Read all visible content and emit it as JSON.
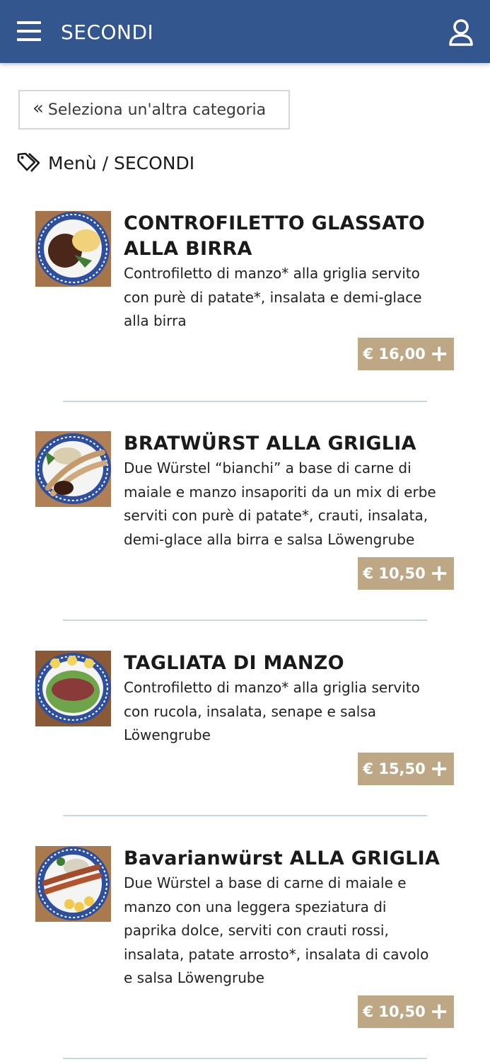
{
  "header": {
    "title": "SECONDI",
    "menu_icon": "hamburger-menu-icon",
    "user_icon": "user-icon"
  },
  "back_button": {
    "icon": "double-chevron-left-icon",
    "label": "Seleziona un'altra categoria"
  },
  "breadcrumb": {
    "icon": "tags-icon",
    "text": "Menù / SECONDI"
  },
  "colors": {
    "header_bg": "#33568f",
    "price_bg": "#bda784",
    "divider": "#c9d6e6"
  },
  "items": [
    {
      "title_lines": [
        "CONTROFILETTO GLASSATO",
        "ALLA BIRRA"
      ],
      "desc_lines": [
        "Controfiletto di manzo* alla griglia servito",
        "con purè di patate*, insalata e demi-glace",
        "alla birra"
      ],
      "price": "€ 16,00"
    },
    {
      "title_lines": [
        "BRATWÜRST ALLA GRIGLIA"
      ],
      "desc_lines": [
        "Due Würstel “bianchi” a base di carne di",
        "maiale e manzo insaporiti da un mix di erbe",
        "serviti con purè di patate*, crauti, insalata,",
        "demi-glace alla birra e salsa Löwengrube"
      ],
      "price": "€ 10,50"
    },
    {
      "title_lines": [
        "TAGLIATA DI MANZO"
      ],
      "desc_lines": [
        "Controfiletto di manzo* alla griglia servito",
        "con rucola, insalata, senape e salsa",
        "Löwengrube"
      ],
      "price": "€ 15,50"
    },
    {
      "title_lines": [
        "Bavarianwürst ALLA GRIGLIA"
      ],
      "desc_lines": [
        "Due Würstel a base di carne di maiale e",
        "manzo con una leggera speziatura di",
        "paprika dolce, serviti con crauti rossi,",
        "insalata, patate arrosto*, insalata di cavolo",
        "e salsa Löwengrube"
      ],
      "price": "€ 10,50"
    }
  ]
}
